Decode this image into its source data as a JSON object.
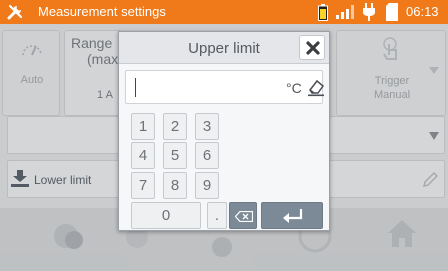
{
  "status_bar": {
    "title": "Measurement settings",
    "time": "06:13"
  },
  "background": {
    "auto_tile": {
      "label": "Auto"
    },
    "range_tile": {
      "label_line1": "Range",
      "label_line2": "(max",
      "value": "1 A"
    },
    "trigger_tile": {
      "label_line1": "Trigger",
      "label_line2": "Manual"
    },
    "lower_limit": {
      "label": "Lower limit"
    }
  },
  "dialog": {
    "title": "Upper limit",
    "input_value": "",
    "unit": "°C",
    "keys": {
      "k1": "1",
      "k2": "2",
      "k3": "3",
      "k4": "4",
      "k5": "5",
      "k6": "6",
      "k7": "7",
      "k8": "8",
      "k9": "9",
      "k0": "0",
      "dot": "."
    }
  },
  "icons": {
    "wrench": "wrench-icon",
    "battery": "battery-icon",
    "signal": "signal-icon",
    "plug": "plug-icon",
    "sd_card": "sd-card-icon",
    "close": "close-icon",
    "erase": "erase-icon",
    "backspace": "backspace-icon",
    "enter": "enter-icon",
    "download": "download-icon",
    "pencil": "pencil-icon",
    "dropdown": "chevron-down-icon",
    "home": "home-icon"
  },
  "colors": {
    "status_bar": "#f07a1a",
    "enter_key": "#7c8a97"
  }
}
